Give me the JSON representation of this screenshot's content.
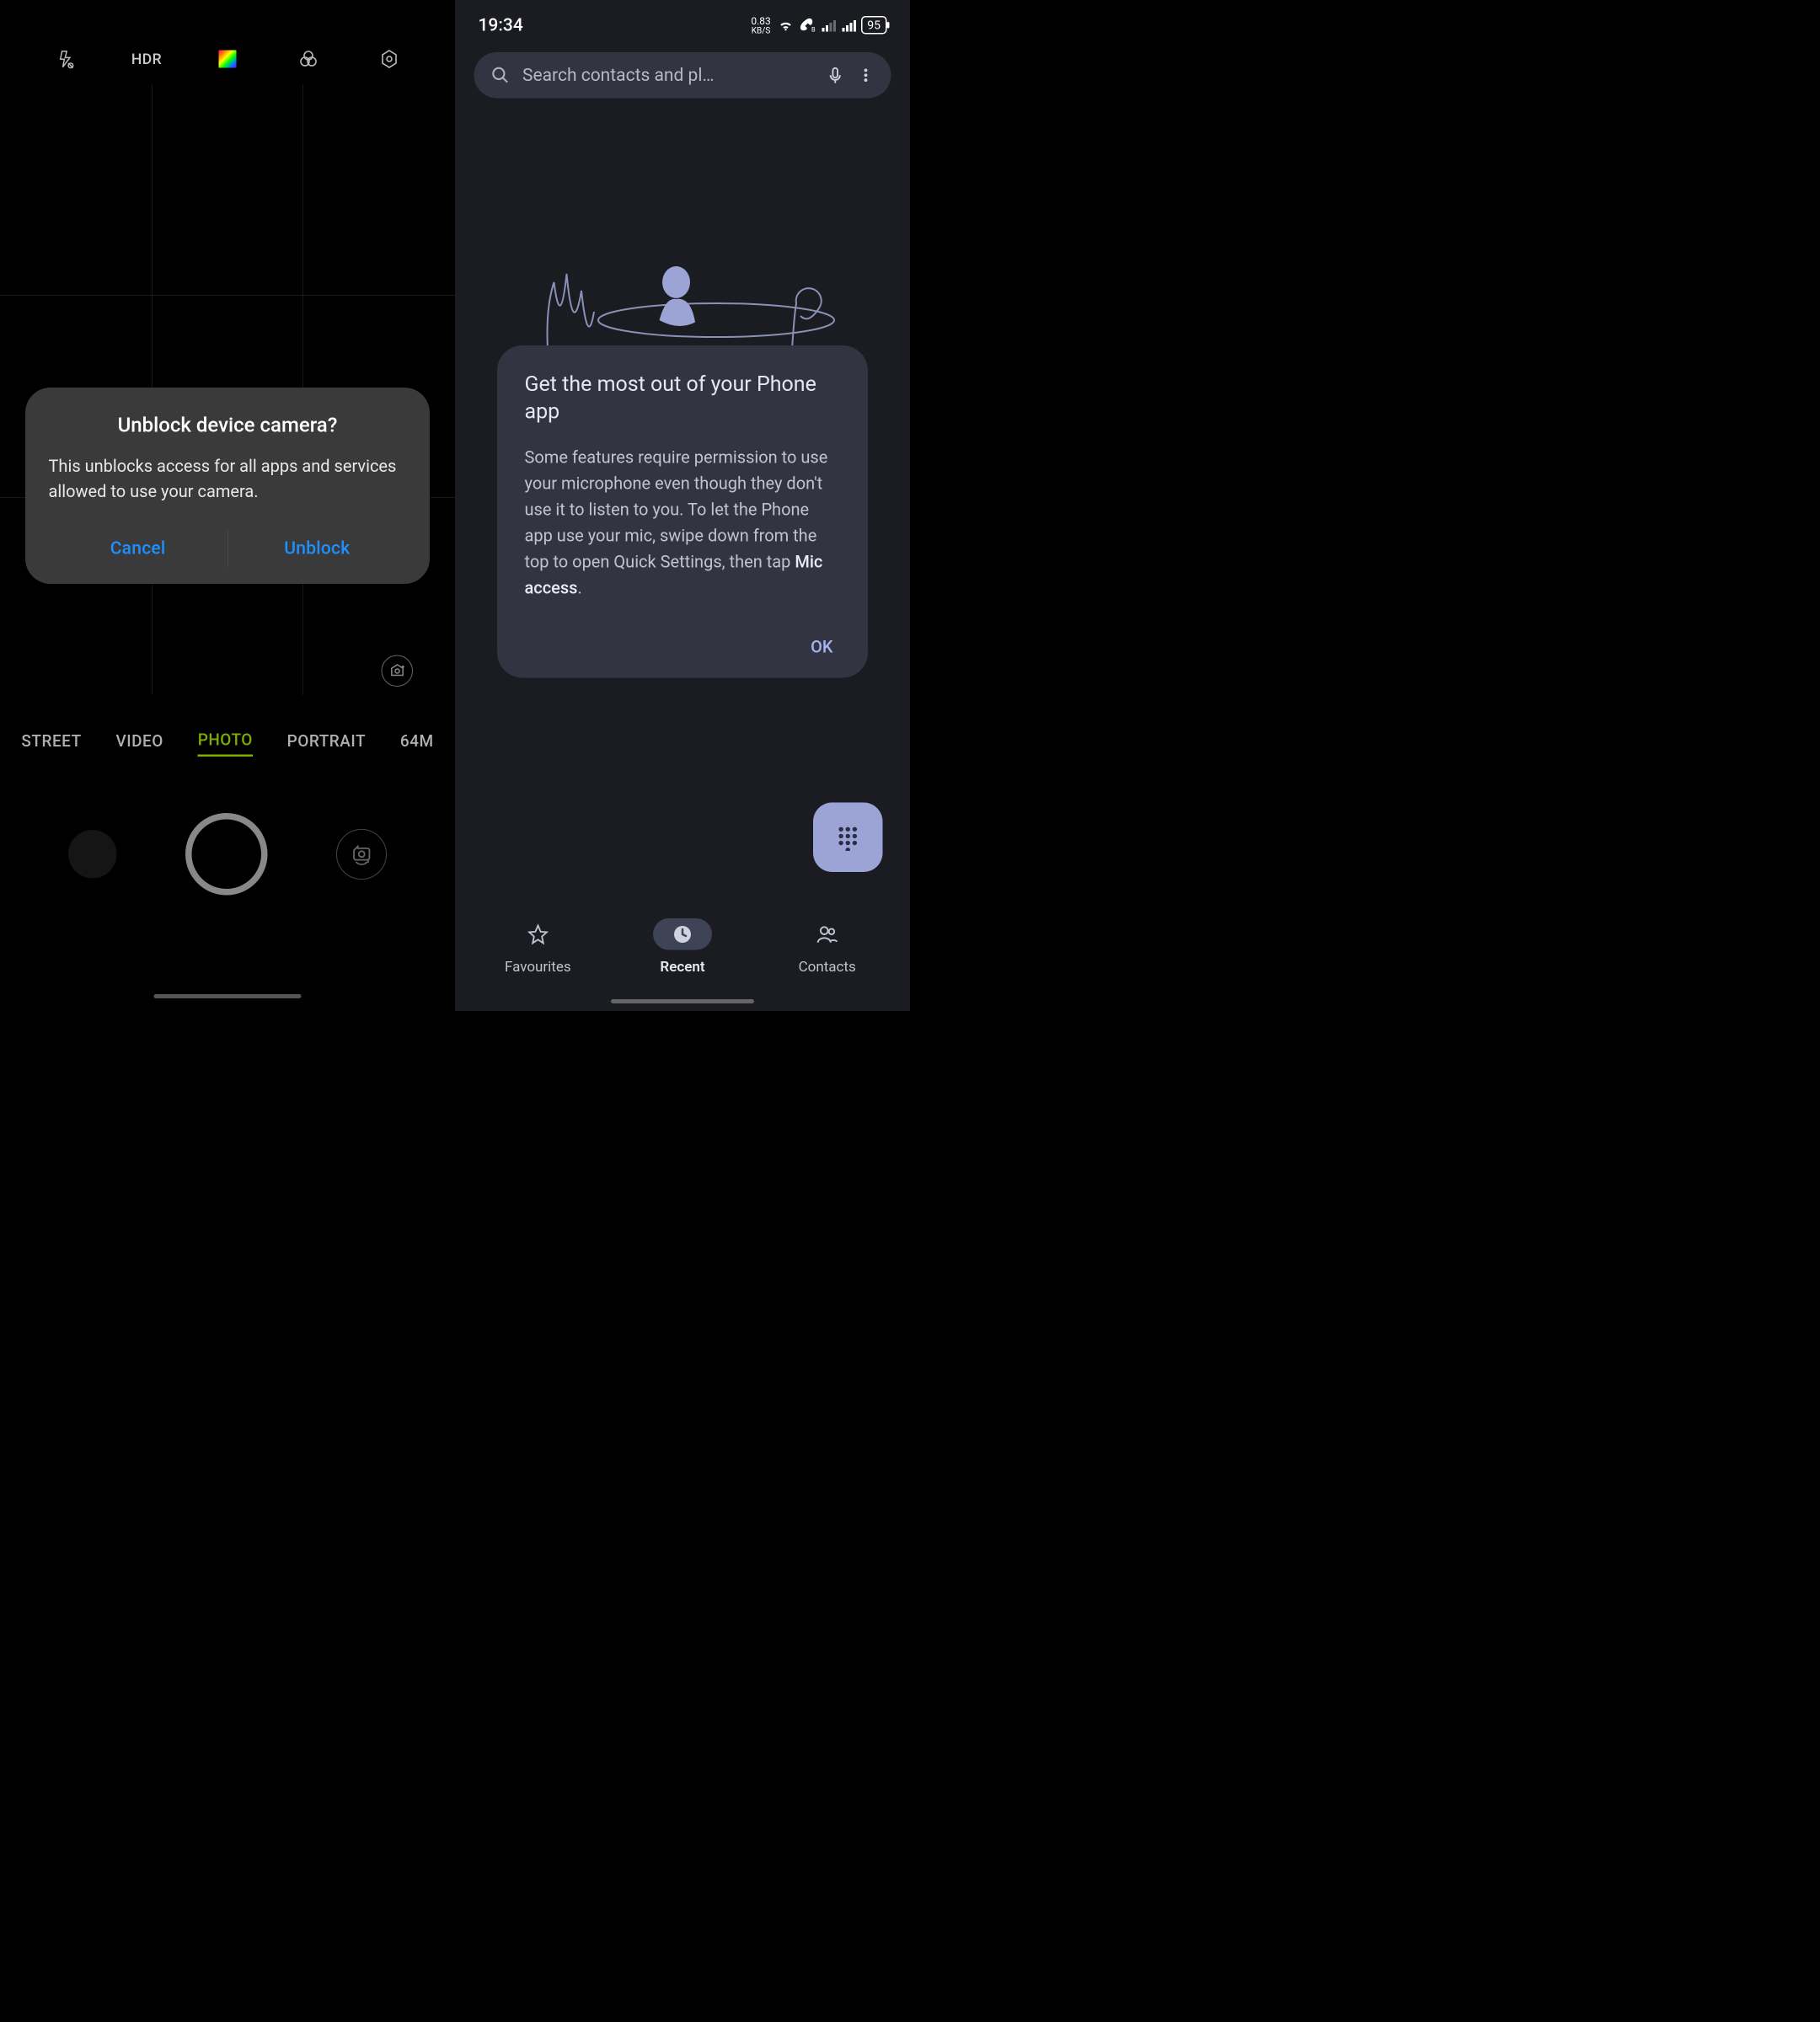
{
  "left": {
    "toolbar": {
      "hdr_label": "HDR"
    },
    "dialog": {
      "title": "Unblock device camera?",
      "body": "This unblocks access for all apps and services allowed to use your camera.",
      "cancel": "Cancel",
      "confirm": "Unblock"
    },
    "modes": {
      "street": "STREET",
      "video": "VIDEO",
      "photo": "PHOTO",
      "portrait": "PORTRAIT",
      "sixtyfour": "64M"
    }
  },
  "right": {
    "status": {
      "time": "19:34",
      "net_speed": "0.83",
      "net_unit": "KB/S",
      "battery": "95"
    },
    "search": {
      "placeholder": "Search contacts and pl…"
    },
    "card": {
      "title": "Get the most out of your Phone app",
      "body_pre": "Some features require permission to use your microphone even though they don't use it to listen to you. To let the Phone app use your mic, swipe down from the top to open Quick Settings, then tap ",
      "body_bold": "Mic access",
      "body_post": ".",
      "ok": "OK"
    },
    "nav": {
      "favourites": "Favourites",
      "recent": "Recent",
      "contacts": "Contacts"
    }
  }
}
